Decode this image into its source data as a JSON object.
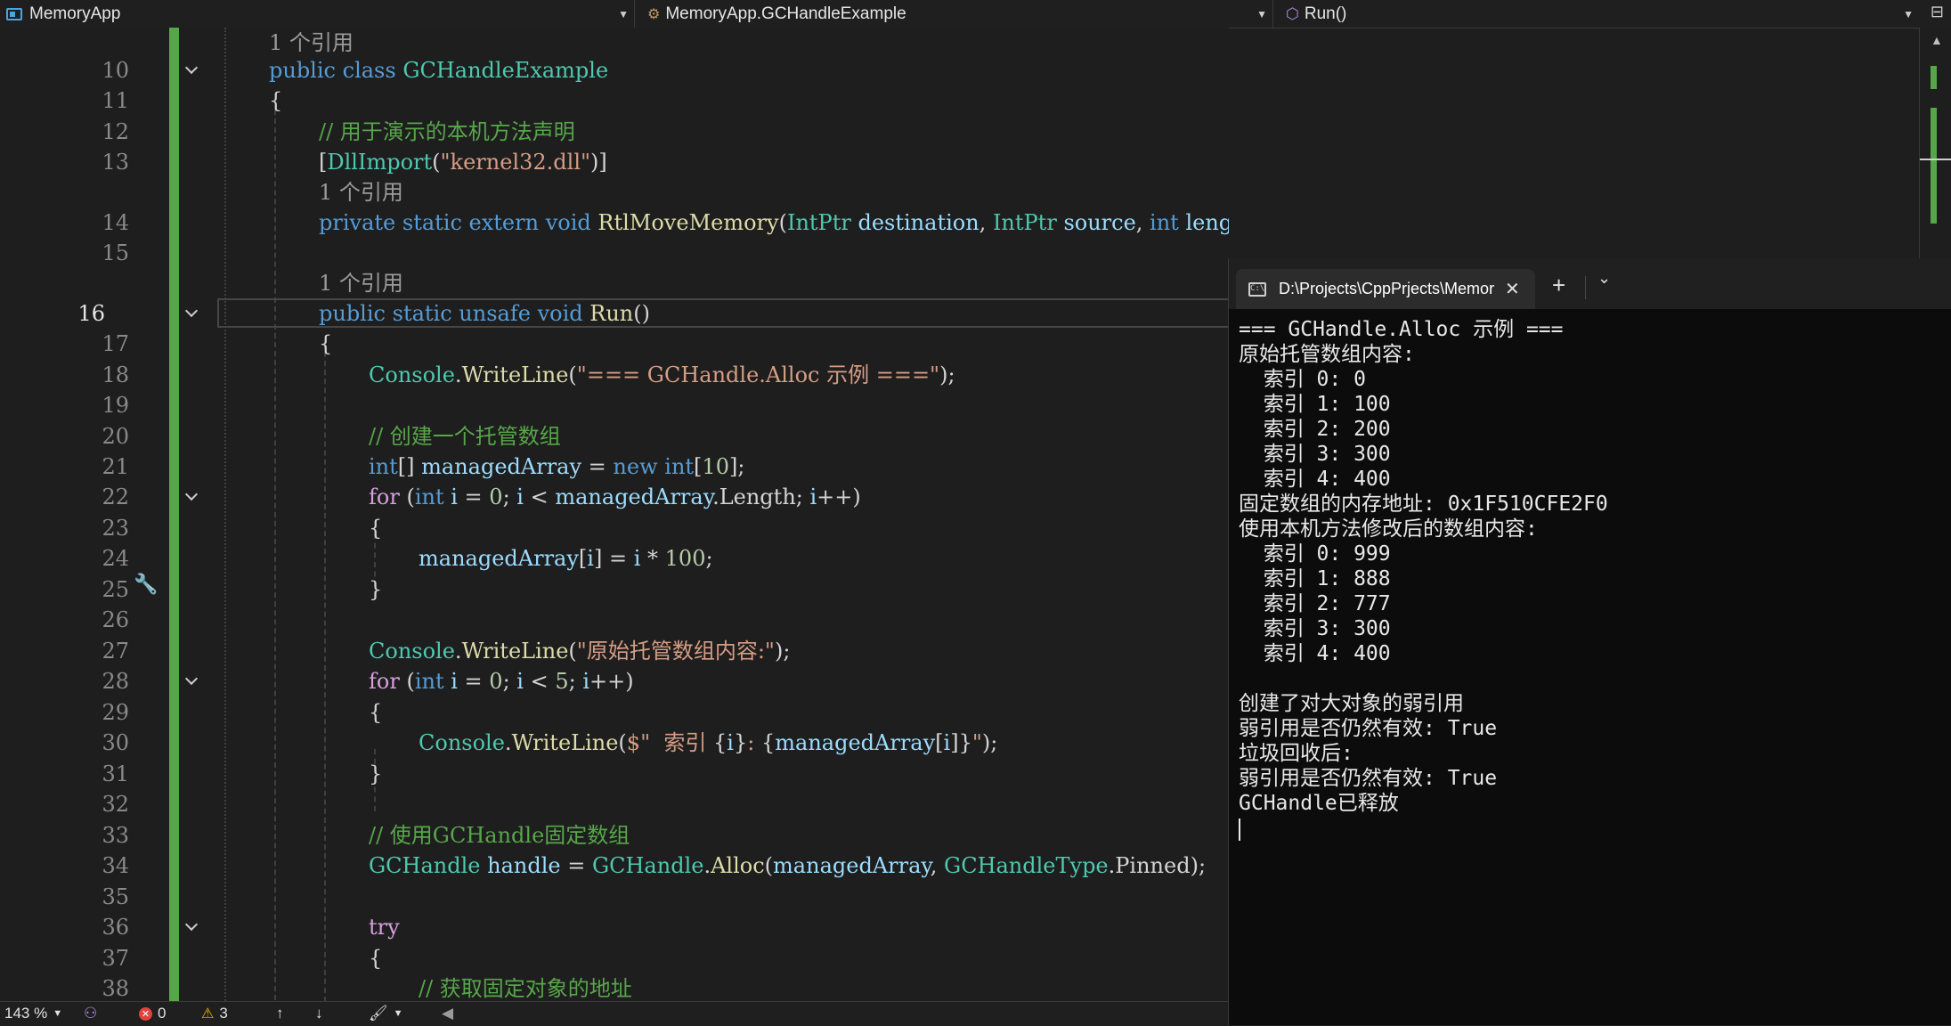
{
  "navbar": {
    "project": "MemoryApp",
    "class": "MemoryApp.GCHandleExample",
    "member": "Run()",
    "project_icon": "csharp-project-icon",
    "class_icon": "class-icon",
    "member_icon": "method-cube-icon"
  },
  "editor": {
    "lines": [
      {
        "num": "",
        "ref": "1 个引用"
      },
      {
        "num": "10",
        "code": "public class GCHandleExample"
      },
      {
        "num": "11",
        "code": "{"
      },
      {
        "num": "12",
        "code": "// 用于演示的本机方法声明"
      },
      {
        "num": "13",
        "code": "[DllImport(\"kernel32.dll\")]"
      },
      {
        "num": "",
        "ref": "1 个引用"
      },
      {
        "num": "14",
        "code": "private static extern void RtlMoveMemory(IntPtr destination, IntPtr source, int length);"
      },
      {
        "num": "15",
        "code": ""
      },
      {
        "num": "",
        "ref": "1 个引用"
      },
      {
        "num": "16",
        "code": "public static unsafe void Run()"
      },
      {
        "num": "17",
        "code": "{"
      },
      {
        "num": "18",
        "code": "Console.WriteLine(\"=== GCHandle.Alloc 示例 ===\");"
      },
      {
        "num": "19",
        "code": ""
      },
      {
        "num": "20",
        "code": "// 创建一个托管数组"
      },
      {
        "num": "21",
        "code": "int[] managedArray = new int[10];"
      },
      {
        "num": "22",
        "code": "for (int i = 0; i < managedArray.Length; i++)"
      },
      {
        "num": "23",
        "code": "{"
      },
      {
        "num": "24",
        "code": "managedArray[i] = i * 100;"
      },
      {
        "num": "25",
        "code": "}"
      },
      {
        "num": "26",
        "code": ""
      },
      {
        "num": "27",
        "code": "Console.WriteLine(\"原始托管数组内容:\");"
      },
      {
        "num": "28",
        "code": "for (int i = 0; i < 5; i++)"
      },
      {
        "num": "29",
        "code": "{"
      },
      {
        "num": "30",
        "code": "Console.WriteLine($\"  索引 {i}: {managedArray[i]}\");"
      },
      {
        "num": "31",
        "code": "}"
      },
      {
        "num": "32",
        "code": ""
      },
      {
        "num": "33",
        "code": "// 使用GCHandle固定数组"
      },
      {
        "num": "34",
        "code": "GCHandle handle = GCHandle.Alloc(managedArray, GCHandleType.Pinned);"
      },
      {
        "num": "35",
        "code": ""
      },
      {
        "num": "36",
        "code": "try"
      },
      {
        "num": "37",
        "code": "{"
      },
      {
        "num": "38",
        "code": "// 获取固定对象的地址"
      }
    ]
  },
  "terminal": {
    "tab_title": "D:\\Projects\\CppPrjects\\Memor",
    "tab_icon_text": "C:\\",
    "new_tab": "+",
    "output": [
      "=== GCHandle.Alloc 示例 ===",
      "原始托管数组内容:",
      "  索引 0: 0",
      "  索引 1: 100",
      "  索引 2: 200",
      "  索引 3: 300",
      "  索引 4: 400",
      "固定数组的内存地址: 0x1F510CFE2F0",
      "使用本机方法修改后的数组内容:",
      "  索引 0: 999",
      "  索引 1: 888",
      "  索引 2: 777",
      "  索引 3: 300",
      "  索引 4: 400",
      "",
      "创建了对大对象的弱引用",
      "弱引用是否仍然有效: True",
      "垃圾回收后:",
      "弱引用是否仍然有效: True",
      "GCHandle已释放"
    ]
  },
  "status": {
    "zoom": "143 %",
    "errors": "0",
    "warnings": "3"
  },
  "colors": {
    "keyword": "#569cd6",
    "type": "#4ec9b0",
    "string": "#d69d85",
    "comment": "#57a64a",
    "number": "#b5cea8",
    "method": "#dcdcaa",
    "identifier": "#9cdcfe",
    "change_bar": "#57a64a"
  }
}
